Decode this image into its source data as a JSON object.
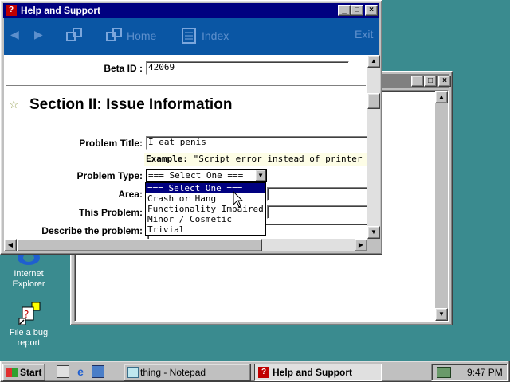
{
  "desktop": {
    "icons": [
      {
        "label_line1": "Internet",
        "label_line2": "Explorer"
      },
      {
        "label_line1": "File a bug",
        "label_line2": "report"
      }
    ]
  },
  "help_window": {
    "title": "Help and Support",
    "toolbar": {
      "home_label": "Home",
      "index_label": "Index",
      "exit_label": "Exit"
    },
    "beta_id": {
      "label": "Beta ID :",
      "value": "42069"
    },
    "section_heading": "Section II: Issue Information",
    "problem_title": {
      "label": "Problem Title:",
      "value": "I eat penis"
    },
    "example": {
      "label": "Example:",
      "text": "\"Script error instead of printer proper"
    },
    "problem_type": {
      "label": "Problem Type:",
      "selected": "=== Select One ===",
      "options": [
        "=== Select One ===",
        "Crash or Hang",
        "Functionality Impaired",
        "Minor / Cosmetic",
        "Trivial"
      ]
    },
    "area_label": "Area:",
    "this_problem_label": "This Problem:",
    "describe_label": "Describe the problem:"
  },
  "taskbar": {
    "start_label": "Start",
    "tasks": [
      {
        "label": "thing - Notepad"
      },
      {
        "label": "Help and Support"
      }
    ],
    "clock": "9:47 PM"
  },
  "colors": {
    "desktop": "#3a8b8f",
    "title_active": "#000080",
    "toolbar": "#0a56a4"
  }
}
